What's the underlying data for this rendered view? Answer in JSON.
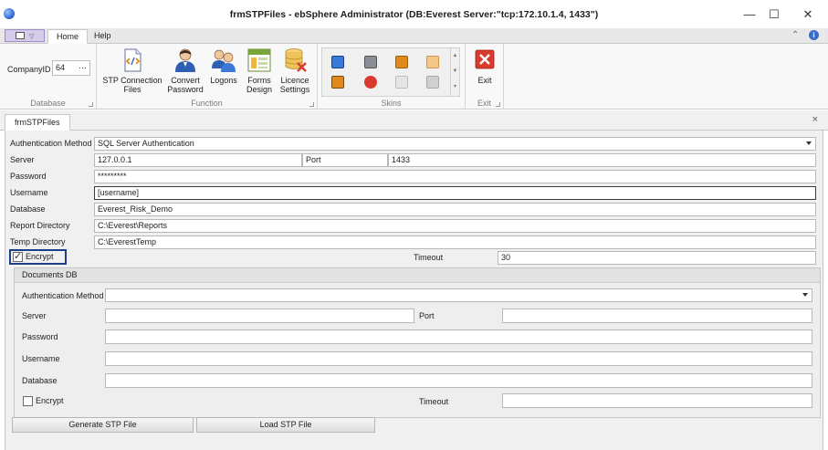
{
  "window": {
    "title": "frmSTPFiles - ebSphere Administrator (DB:Everest Server:\"tcp:172.10.1.4, 1433\")",
    "minimize_glyph": "—",
    "maximize_glyph": "☐",
    "close_glyph": "✕"
  },
  "ribbon_tabs": [
    "Home",
    "Help"
  ],
  "ribbon_tab_icons": {
    "collapse_glyph": "⌃",
    "info_glyph": "i"
  },
  "ribbon": {
    "database_group": {
      "label": "Database",
      "company_label": "CompanyID",
      "company_value": "64",
      "browse_glyph": "···"
    },
    "function_group": {
      "label": "Function",
      "buttons": [
        {
          "line1": "STP Connection",
          "line2": "Files",
          "icon": "stp-files-icon"
        },
        {
          "line1": "Convert",
          "line2": "Password",
          "icon": "user-convert-icon"
        },
        {
          "line1": "Logons",
          "line2": "",
          "icon": "users-icon"
        },
        {
          "line1": "Forms",
          "line2": "Design",
          "icon": "form-design-icon"
        },
        {
          "line1": "Licence",
          "line2": "Settings",
          "icon": "licence-icon"
        }
      ]
    },
    "skins_group": {
      "label": "Skins"
    },
    "exit_group": {
      "label": "Exit",
      "exit_button": "Exit"
    }
  },
  "document_tab": {
    "label": "frmSTPFiles",
    "close_glyph": "×"
  },
  "main_db": {
    "auth_label": "Authentication Method",
    "auth_value": "SQL Server Authentication",
    "server_label": "Server",
    "server_value": "127.0.0.1",
    "port_label": "Port",
    "port_value": "1433",
    "password_label": "Password",
    "password_value": "*********",
    "username_label": "Username",
    "username_value": "[username]",
    "database_label": "Database",
    "database_value": "Everest_Risk_Demo",
    "report_dir_label": "Report Directory",
    "report_dir_value": "C:\\Everest\\Reports",
    "temp_dir_label": "Temp Directory",
    "temp_dir_value": "C:\\EverestTemp",
    "encrypt_label": "Encrypt",
    "encrypt_checked": true,
    "timeout_label": "Timeout",
    "timeout_value": "30"
  },
  "documents_db": {
    "title": "Documents DB",
    "auth_label": "Authentication Method",
    "auth_value": "",
    "server_label": "Server",
    "server_value": "",
    "port_label": "Port",
    "port_value": "",
    "password_label": "Password",
    "password_value": "",
    "username_label": "Username",
    "username_value": "",
    "database_label": "Database",
    "database_value": "",
    "encrypt_label": "Encrypt",
    "encrypt_checked": false,
    "timeout_label": "Timeout",
    "timeout_value": ""
  },
  "buttons": {
    "generate": "Generate STP File",
    "load": "Load STP File"
  },
  "colors": {
    "accent": "#1d3f8a",
    "exit_red": "#d93a2e",
    "app_menu": "#d4ccea"
  }
}
